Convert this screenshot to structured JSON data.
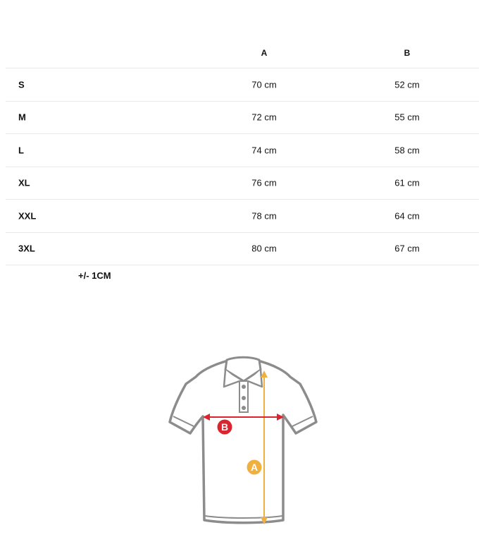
{
  "table": {
    "headers": {
      "size": "",
      "a": "A",
      "b": "B"
    },
    "rows": [
      {
        "size": "S",
        "a": "70 cm",
        "b": "52 cm"
      },
      {
        "size": "M",
        "a": "72 cm",
        "b": "55 cm"
      },
      {
        "size": "L",
        "a": "74 cm",
        "b": "58 cm"
      },
      {
        "size": "XL",
        "a": "76 cm",
        "b": "61 cm"
      },
      {
        "size": "XXL",
        "a": "78 cm",
        "b": "64 cm"
      },
      {
        "size": "3XL",
        "a": "80 cm",
        "b": "67 cm"
      }
    ]
  },
  "tolerance": "+/- 1CM",
  "figure": {
    "label_a": "A",
    "label_b": "B",
    "colors": {
      "outline": "#8c8c8c",
      "arrow_a": "#f0b040",
      "arrow_b": "#d9252f"
    }
  }
}
